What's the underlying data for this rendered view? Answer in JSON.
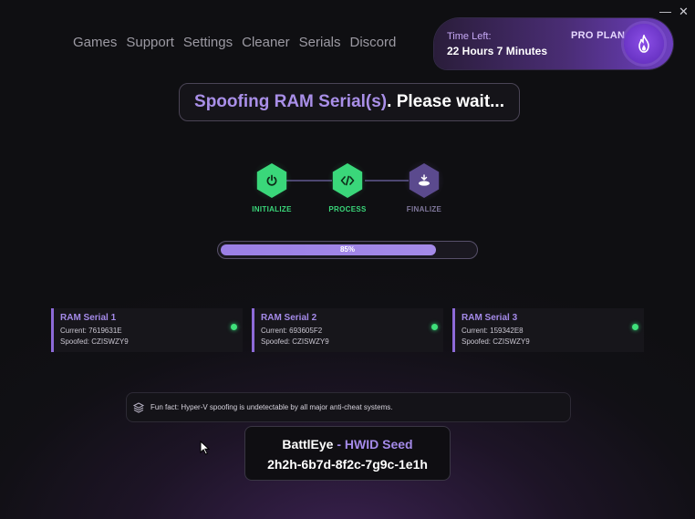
{
  "window_controls": {
    "minimize": "—",
    "close": "✕"
  },
  "nav": {
    "items": [
      "Games",
      "Support",
      "Settings",
      "Cleaner",
      "Serials",
      "Discord"
    ]
  },
  "plan": {
    "time_left_label": "Time Left:",
    "time_left_value": "22 Hours 7 Minutes",
    "plan_name": "PRO PLAN",
    "icon": "flame-icon"
  },
  "headline": {
    "accent": "Spoofing RAM Serial(s)",
    "rest": ". Please wait..."
  },
  "steps": [
    {
      "label": "INITIALIZE",
      "icon": "power-icon",
      "state": "done"
    },
    {
      "label": "PROCESS",
      "icon": "code-icon",
      "state": "done"
    },
    {
      "label": "FINALIZE",
      "icon": "finish-icon",
      "state": "active"
    }
  ],
  "progress": {
    "value": 0.85,
    "label": "85%"
  },
  "serials": [
    {
      "title": "RAM Serial 1",
      "current": "Current: 7619631E",
      "spoofed": "Spoofed: CZISWZY9"
    },
    {
      "title": "RAM Serial 2",
      "current": "Current: 693605F2",
      "spoofed": "Spoofed: CZISWZY9"
    },
    {
      "title": "RAM Serial 3",
      "current": "Current: 159342E8",
      "spoofed": "Spoofed: CZISWZY9"
    }
  ],
  "fun_fact": {
    "text": "Fun fact: Hyper-V spoofing is undetectable by all major anti-cheat systems.",
    "icon": "layers-icon"
  },
  "seed": {
    "title_a": "BattlEye",
    "title_b": " - HWID Seed",
    "value": "2h2h-6b7d-8f2c-7g9c-1e1h"
  },
  "colors": {
    "accent": "#a48ae8",
    "success": "#3fe07a",
    "background": "#111015"
  }
}
